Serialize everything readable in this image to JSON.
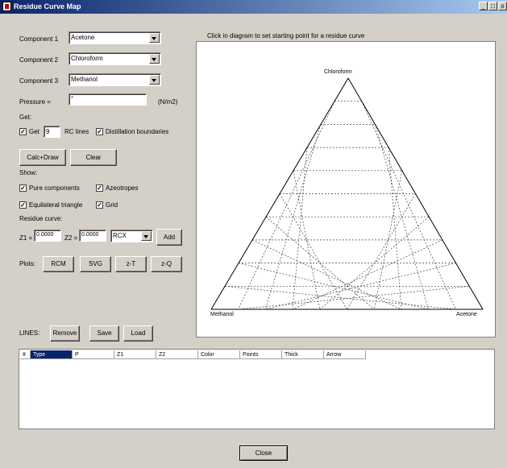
{
  "window": {
    "title": "Residue Curve Map",
    "buttons": {
      "minimize": "_",
      "maximize": "□",
      "close": "x"
    }
  },
  "components": [
    {
      "label": "Component 1",
      "value": "Acetone"
    },
    {
      "label": "Component 2",
      "value": "Chloroform"
    },
    {
      "label": "Component 3",
      "value": "Methanol"
    }
  ],
  "pressure": {
    "label": "Pressure =",
    "value": "*",
    "unit": "(N/m2)"
  },
  "get": {
    "heading": "Get:",
    "get_label": "Get",
    "rc_count": "9",
    "rc_lines_label": "RC lines",
    "distillation_label": "Distillation boundaries",
    "get_checked": true,
    "distillation_checked": true
  },
  "actions": {
    "calc_draw": "Calc+Draw",
    "clear": "Clear"
  },
  "show": {
    "heading": "Show:",
    "pure_components": "Pure components",
    "azeotropes": "Azeotropes",
    "equilateral": "Equilateral triangle",
    "grid": "Grid"
  },
  "residue_curve": {
    "heading": "Residue curve:",
    "z1_label": "Z1 =",
    "z1_value": "0.0000",
    "z2_label": "Z2 =",
    "z2_value": "0.0000",
    "mode": "RCX",
    "add": "Add"
  },
  "plots": {
    "label": "Plots:",
    "rcm": "RCM",
    "svg": "SVG",
    "zt": "z-T",
    "zq": "z-Q"
  },
  "lines": {
    "label": "LINES:",
    "remove": "Remove",
    "save": "Save",
    "load": "Load"
  },
  "diagram": {
    "hint": "Click in diagram to set starting point for a residue curve",
    "top_vertex": "Chloroform",
    "left_vertex": "Methanol",
    "right_vertex": "Acetone",
    "grid_divisions": 10,
    "grid_color": "#404040"
  },
  "table": {
    "columns": [
      "#",
      "Type",
      "P",
      "Z1",
      "Z2",
      "Color",
      "Points",
      "Thick",
      "Arrow"
    ],
    "selected_column": "Type",
    "rows": []
  },
  "footer": {
    "close": "Close"
  },
  "colors": {
    "title_bar": "#0a246a",
    "face": "#d4d0c8",
    "selection": "#0a246a"
  }
}
